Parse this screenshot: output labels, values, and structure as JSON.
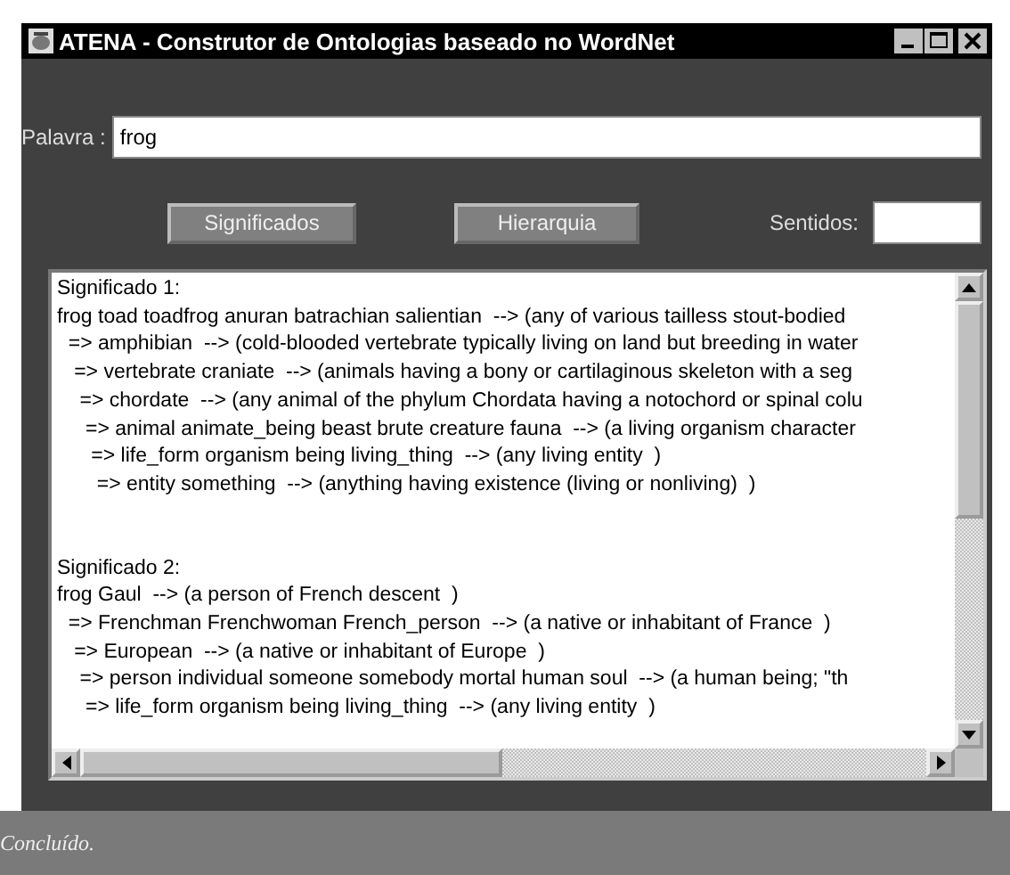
{
  "window": {
    "title": "ATENA - Construtor de Ontologias baseado no WordNet"
  },
  "word_field": {
    "label": "Palavra :",
    "value": "frog"
  },
  "buttons": [
    "Significados",
    "Hierarquia"
  ],
  "senses_field": {
    "label": "Sentidos:"
  },
  "meanings": [
    {
      "heading": "Significado 1:",
      "lines": [
        "frog toad toadfrog anuran batrachian salientian  --> (any of various tailless stout-bodied",
        "  => amphibian  --> (cold-blooded vertebrate typically living on land but breeding in water",
        "   => vertebrate craniate  --> (animals having a bony or cartilaginous skeleton with a seg",
        "    => chordate  --> (any animal of the phylum Chordata having a notochord or spinal colu",
        "     => animal animate_being beast brute creature fauna  --> (a living organism character",
        "      => life_form organism being living_thing  --> (any living entity  )",
        "       => entity something  --> (anything having existence (living or nonliving)  )"
      ]
    },
    {
      "heading": "Significado 2:",
      "lines": [
        "frog Gaul  --> (a person of French descent  )",
        "  => Frenchman Frenchwoman French_person  --> (a native or inhabitant of France  )",
        "   => European  --> (a native or inhabitant of Europe  )",
        "    => person individual someone somebody mortal human soul  --> (a human being; \"th",
        "     => life_form organism being living_thing  --> (any living entity  )"
      ]
    }
  ],
  "status_bar": "Concluído."
}
